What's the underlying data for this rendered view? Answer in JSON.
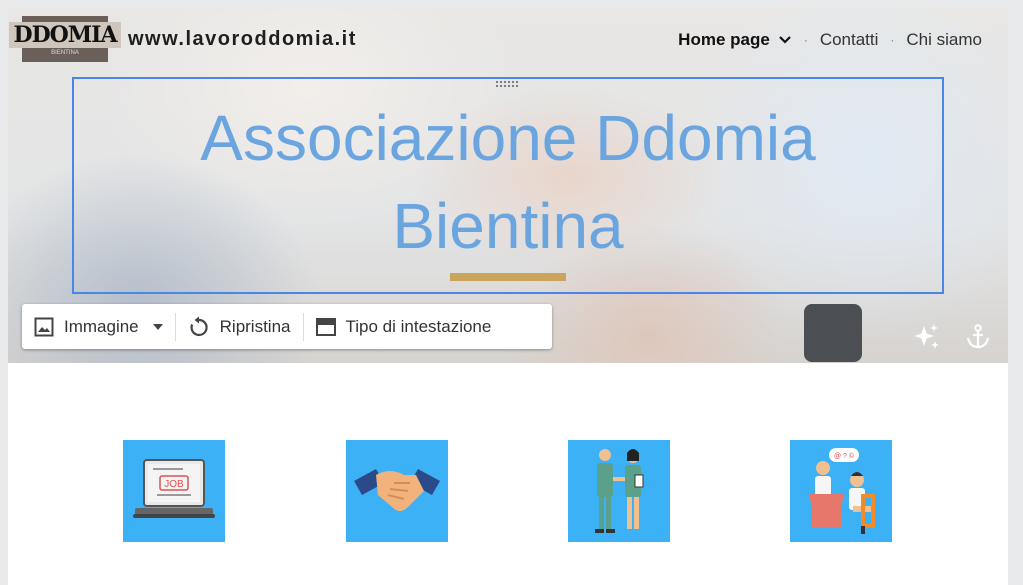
{
  "header": {
    "site_url": "www.lavoroddomia.it",
    "logo_text": "DDOMIA",
    "logo_subtext": "BIENTINA",
    "nav": [
      {
        "label": "Home page",
        "active": true,
        "has_dropdown": true
      },
      {
        "label": "Contatti"
      },
      {
        "label": "Chi siamo"
      }
    ]
  },
  "hero": {
    "title_line1": "Associazione Ddomia",
    "title_line2": "Bientina",
    "accent_color": "#c9a45a",
    "title_color": "#6aa5e0"
  },
  "toolbar": {
    "image_label": "Immagine",
    "reset_label": "Ripristina",
    "header_type_label": "Tipo di intestazione"
  },
  "hero_icons": [
    "sparkle-icon",
    "anchor-icon"
  ],
  "cards": [
    {
      "name": "job-laptop",
      "icon": "laptop-job-icon",
      "text": "JOB"
    },
    {
      "name": "handshake",
      "icon": "handshake-icon"
    },
    {
      "name": "business-people",
      "icon": "business-people-icon"
    },
    {
      "name": "interview",
      "icon": "interview-icon",
      "bubble": "@ ? ©"
    }
  ],
  "colors": {
    "card_bg": "#3db1f5",
    "selection": "#4a86e8"
  }
}
